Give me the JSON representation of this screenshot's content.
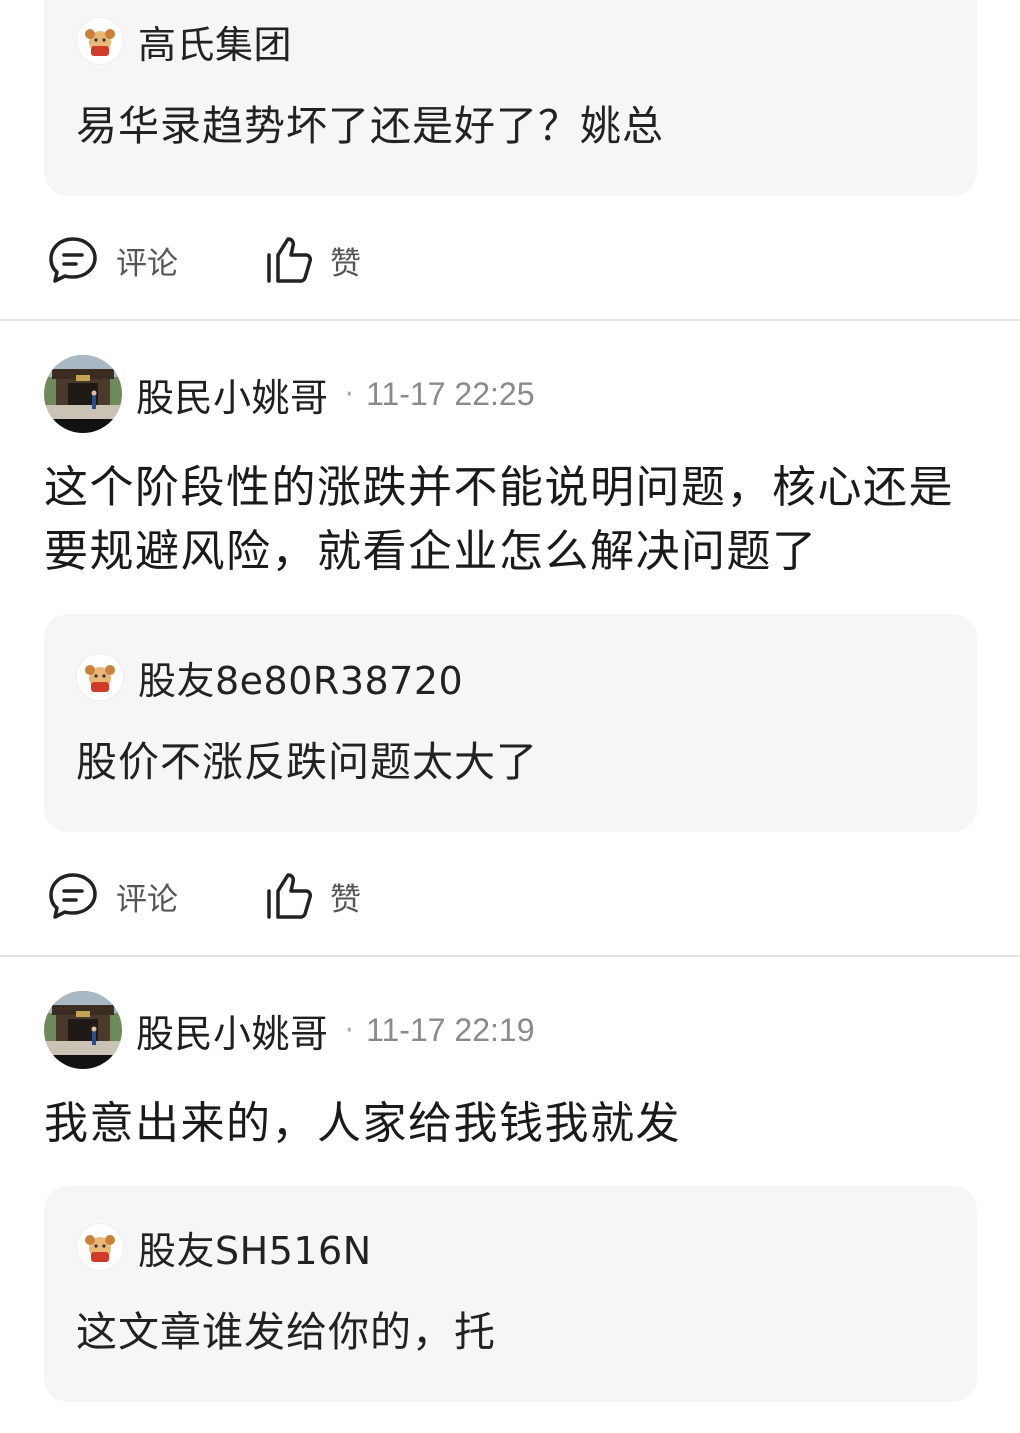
{
  "items": [
    {
      "quote": {
        "user": "高氏集团",
        "text": "易华录趋势坏了还是好了？姚总"
      },
      "actions": {
        "comment": "评论",
        "like": "赞"
      }
    },
    {
      "author": "股民小姚哥",
      "time": "11-17 22:25",
      "text": "这个阶段性的涨跌并不能说明问题，核心还是要规避风险，就看企业怎么解决问题了",
      "quote": {
        "user": "股友8e80R38720",
        "text": "股价不涨反跌问题太大了"
      },
      "actions": {
        "comment": "评论",
        "like": "赞"
      }
    },
    {
      "author": "股民小姚哥",
      "time": "11-17 22:19",
      "text": "我意出来的，人家给我钱我就发",
      "quote": {
        "user": "股友SH516N",
        "text": "这文章谁发给你的，托"
      }
    }
  ],
  "separator": "·",
  "icons": {
    "comment": "comment-bubble-icon",
    "like": "thumbs-up-icon",
    "mini_avatar": "mascot-avatar-icon"
  }
}
